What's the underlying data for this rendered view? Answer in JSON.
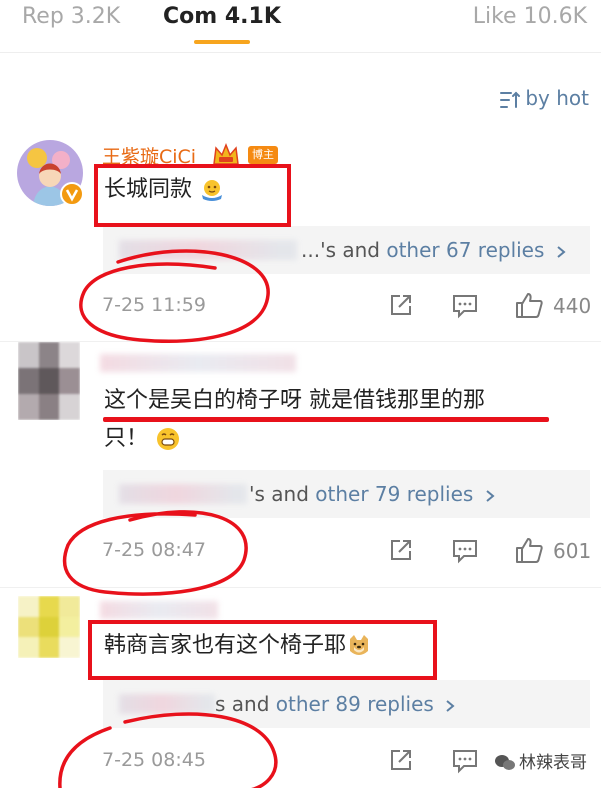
{
  "tabs": {
    "rep": "Rep 3.2K",
    "com": "Com 4.1K",
    "like": "Like 10.6K",
    "active_color": "#f7a51e"
  },
  "sort": {
    "label": "by hot",
    "icon": "sort-lines-icon"
  },
  "comments": [
    {
      "username": "王紫璇CiCi",
      "badge": "博主",
      "text_lines": [
        "长城同款"
      ],
      "emoji": "hug-emoji",
      "replies_suffix": "...'s and",
      "replies_more": "other 67 replies",
      "time": "7-25 11:59",
      "likes": "440"
    },
    {
      "text_lines": [
        "这个是吴白的椅子呀 就是借钱那里的那",
        "只！"
      ],
      "emoji": "grin-emoji",
      "replies_suffix": "'s and",
      "replies_more": "other 79 replies",
      "time": "7-25 08:47",
      "likes": "601"
    },
    {
      "text_lines": [
        "韩商言家也有这个椅子耶"
      ],
      "emoji": "doge-emoji",
      "replies_suffix": "s and",
      "replies_more": "other 89 replies",
      "time": "7-25 08:45",
      "likes": ""
    }
  ],
  "watermark": "林辣表哥",
  "colors": {
    "link": "#5c7fa3",
    "username": "#e86a14",
    "annotation": "#e8111b",
    "badge": "#f58a12"
  }
}
